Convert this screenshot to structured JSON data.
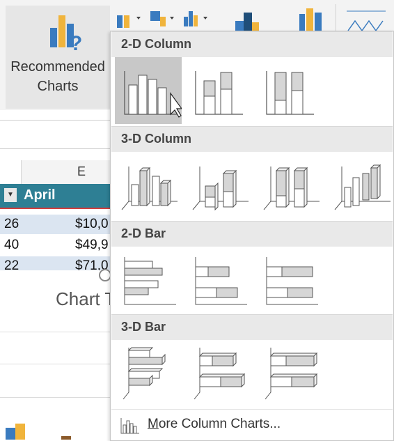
{
  "ribbon": {
    "recommended_label": "Recommended\nCharts"
  },
  "sheet": {
    "column_letter": "E",
    "table_header": "April",
    "rows": [
      {
        "left": "26",
        "right": "$10,0"
      },
      {
        "left": "40",
        "right": "$49,9"
      },
      {
        "left": "22",
        "right": "$71,0"
      }
    ],
    "chart_title": "Chart T"
  },
  "dropdown": {
    "sections": [
      {
        "title": "2-D Column",
        "options": [
          "clustered-column",
          "stacked-column",
          "100-stacked-column"
        ]
      },
      {
        "title": "3-D Column",
        "options": [
          "3d-clustered-column",
          "3d-stacked-column",
          "3d-100-stacked-column",
          "3d-column"
        ]
      },
      {
        "title": "2-D Bar",
        "options": [
          "clustered-bar",
          "stacked-bar",
          "100-stacked-bar"
        ]
      },
      {
        "title": "3-D Bar",
        "options": [
          "3d-clustered-bar",
          "3d-stacked-bar",
          "3d-100-stacked-bar"
        ]
      }
    ],
    "more_label_first": "M",
    "more_label_rest": "ore Column Charts..."
  },
  "colors": {
    "table_header": "#2e7f94",
    "selected_option": "#c8c8c8",
    "section_header": "#e9e9e9"
  }
}
